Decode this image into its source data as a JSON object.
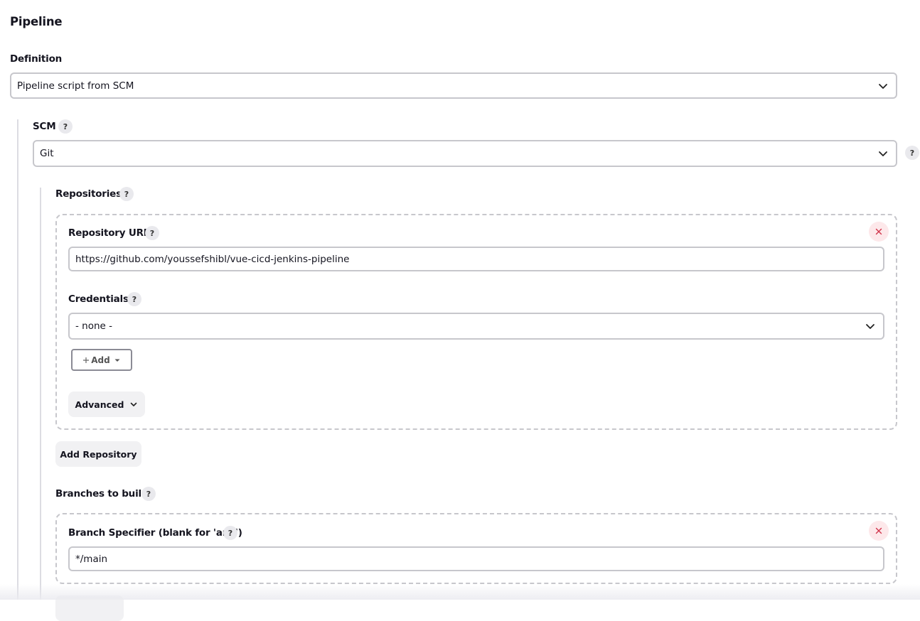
{
  "pipeline": {
    "title": "Pipeline",
    "definition_label": "Definition",
    "definition_value": "Pipeline script from SCM"
  },
  "scm": {
    "label": "SCM",
    "value": "Git"
  },
  "repositories": {
    "label": "Repositories",
    "repository_url_label": "Repository URL",
    "repository_url_value": "https://github.com/youssefshibl/vue-cicd-jenkins-pipeline",
    "credentials_label": "Credentials",
    "credentials_value": "- none -",
    "add_label": "Add",
    "advanced_label": "Advanced",
    "add_repository_label": "Add Repository"
  },
  "branches": {
    "label": "Branches to build",
    "branch_specifier_label": "Branch Specifier (blank for 'any')",
    "branch_specifier_value": "*/main"
  },
  "help_glyph": "?",
  "icons": {
    "chevron": "chevron-down-icon",
    "help": "help-icon",
    "delete": "close-icon",
    "plus": "plus-icon",
    "caret": "caret-down-icon"
  },
  "colors": {
    "delete_icon": "#d0354b",
    "delete_bg": "#fde8ea",
    "border": "#c7c7cc",
    "help_bg": "#e9e9ed"
  }
}
